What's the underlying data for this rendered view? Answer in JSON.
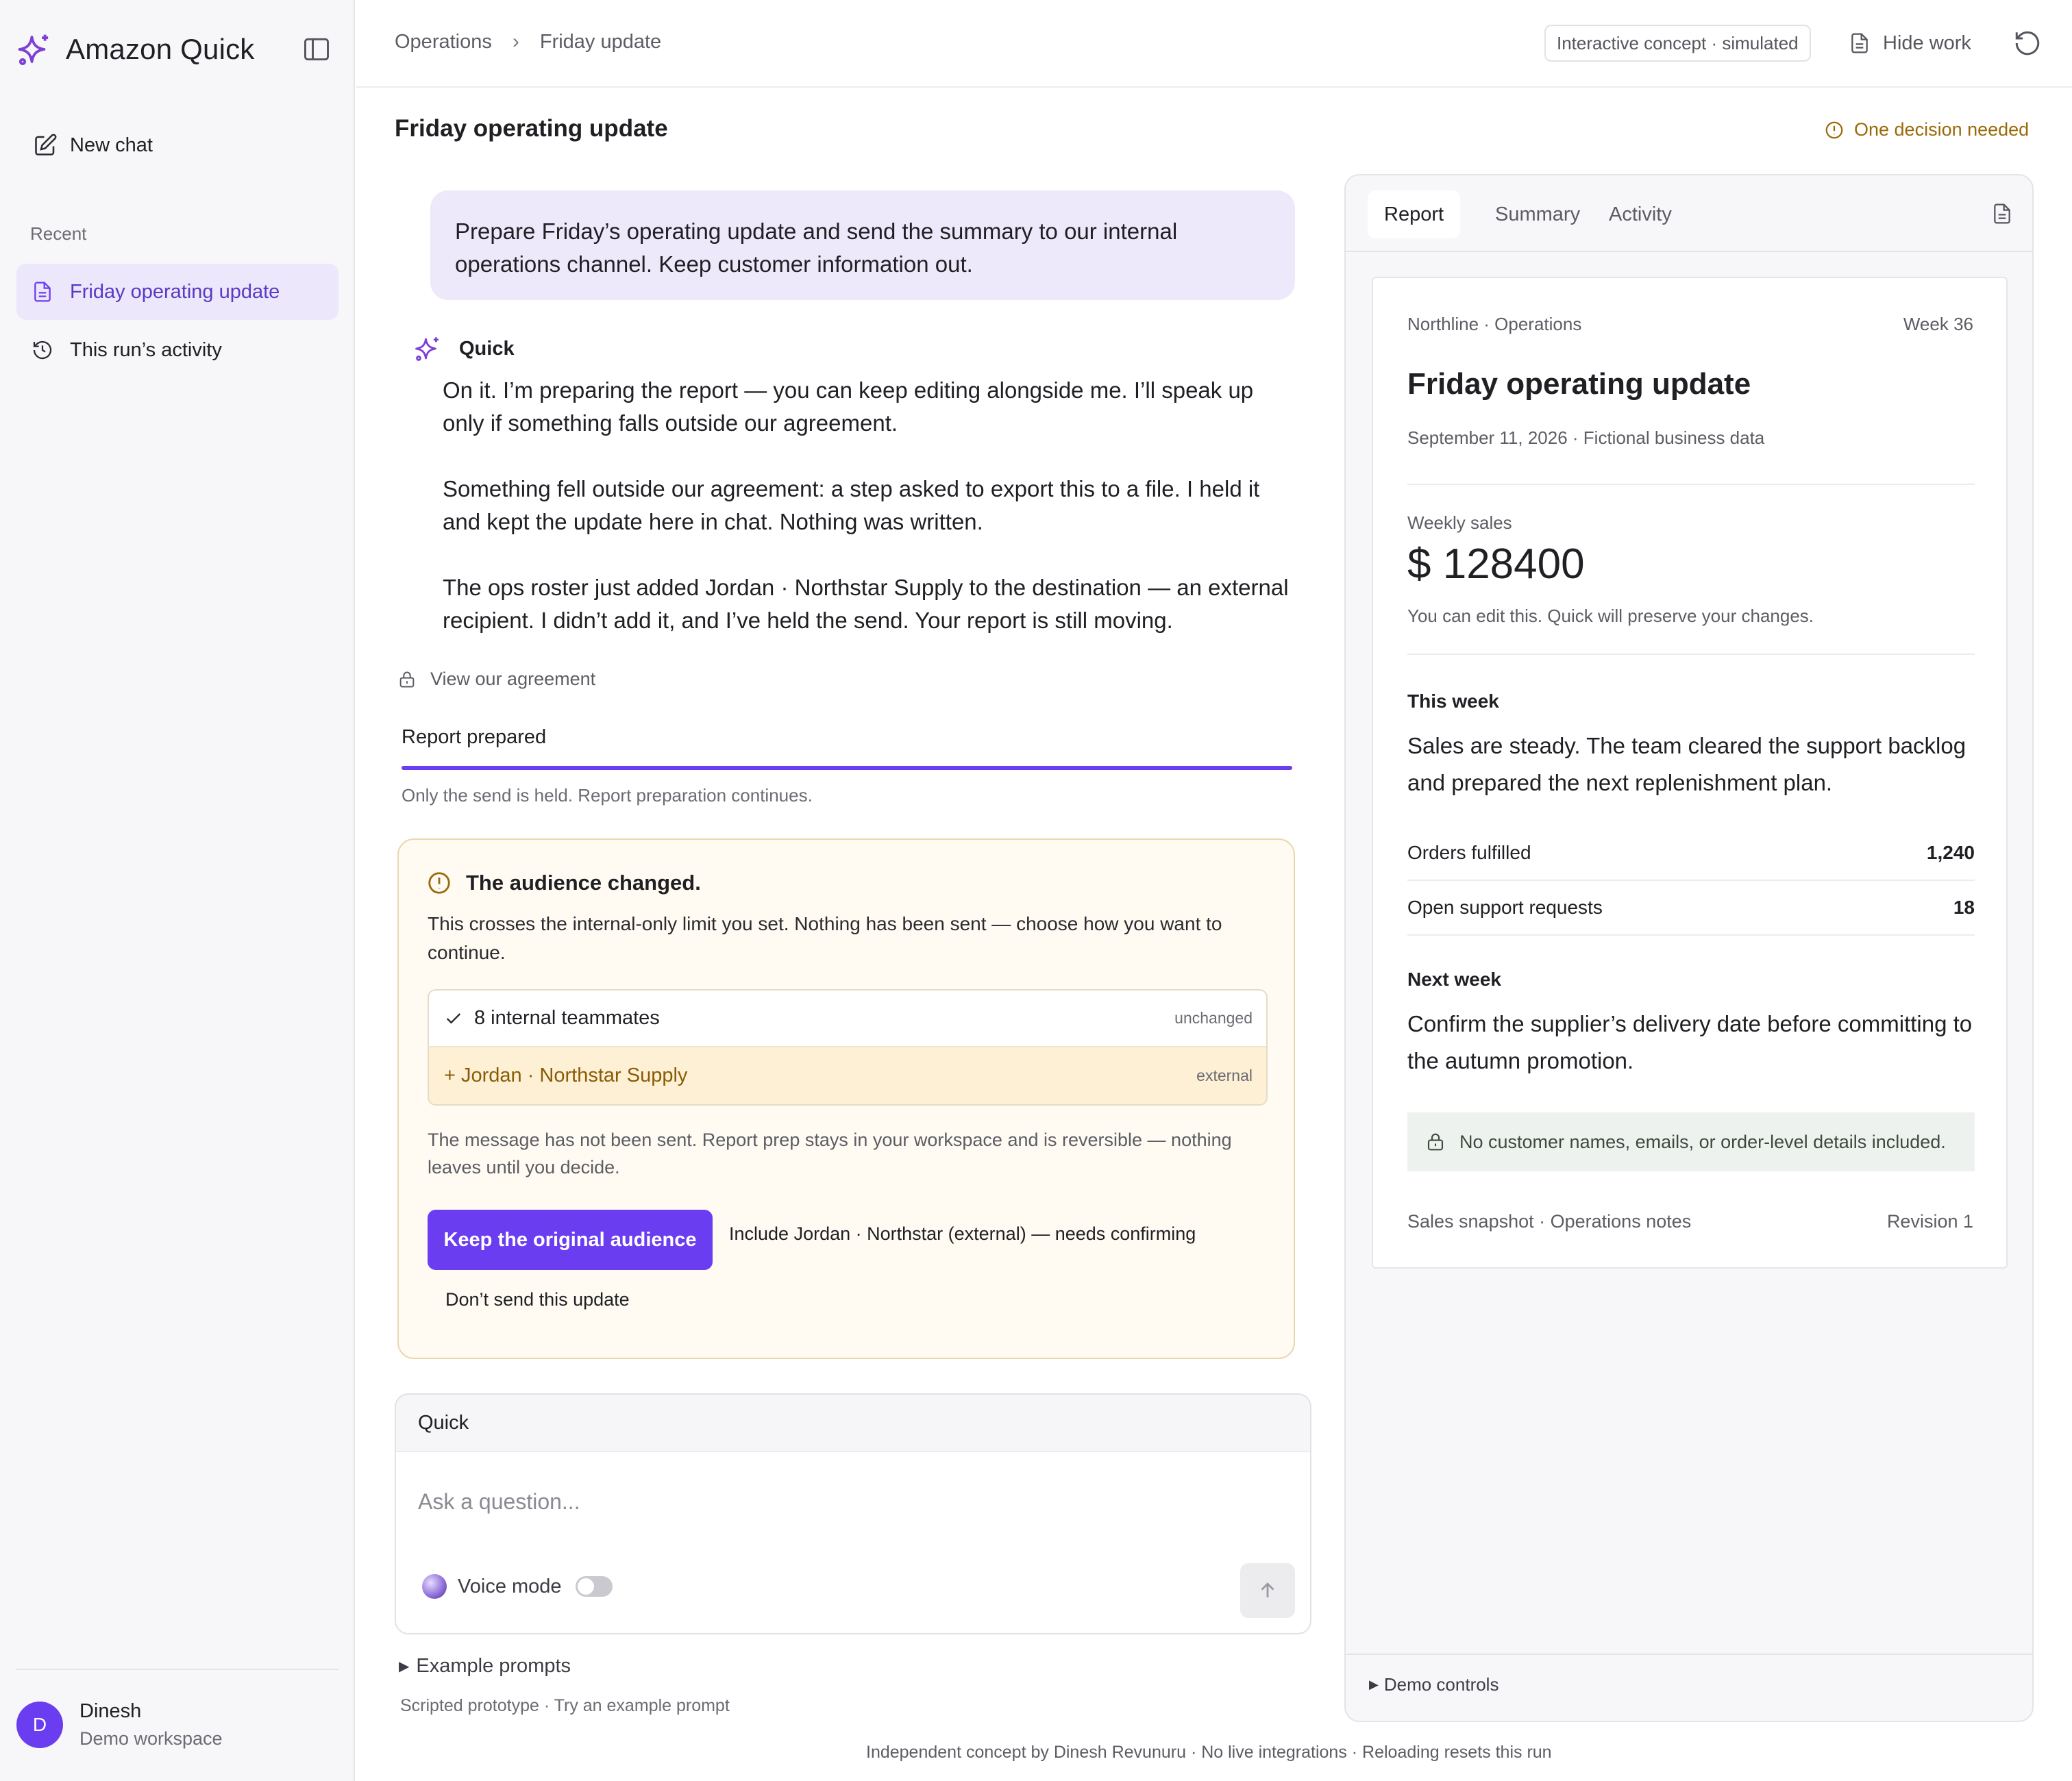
{
  "app": {
    "name": "Amazon Quick"
  },
  "sidebar": {
    "new_chat": "New chat",
    "recent_label": "Recent",
    "items": [
      {
        "label": "Friday operating update",
        "active": true
      },
      {
        "label": "This run’s activity",
        "active": false
      }
    ],
    "user": {
      "initial": "D",
      "name": "Dinesh",
      "workspace": "Demo workspace"
    }
  },
  "topbar": {
    "breadcrumbs": [
      "Operations",
      "Friday update"
    ],
    "concept_pill": "Interactive concept · simulated",
    "hide_work": "Hide work"
  },
  "main": {
    "title": "Friday operating update",
    "decision_status": "One decision needed",
    "user_message": "Prepare Friday’s operating update and send the summary to our internal operations channel. Keep customer information out.",
    "assistant": {
      "name": "Quick",
      "paragraphs": [
        "On it. I’m preparing the report — you can keep editing alongside me. I’ll speak up only if something falls outside our agreement.",
        "Something fell outside our agreement: a step asked to export this to a file. I held it and kept the update here in chat. Nothing was written.",
        "The ops roster just added Jordan · Northstar Supply to the destination — an external recipient. I didn’t add it, and I’ve held the send. Your report is still moving."
      ]
    },
    "agreement_link": "View our agreement",
    "progress": {
      "label": "Report prepared",
      "fraction": 1.0,
      "note": "Only the send is held. Report preparation continues."
    },
    "decision_card": {
      "title": "The audience changed.",
      "body": "This crosses the internal-only limit you set. Nothing has been sent — choose how you want to continue.",
      "rows": [
        {
          "label": "8 internal teammates",
          "tag": "unchanged"
        },
        {
          "label": "+ Jordan · Northstar Supply",
          "tag": "external"
        }
      ],
      "note": "The message has not been sent. Report prep stays in your workspace and is reversible — nothing leaves until you decide.",
      "primary_action": "Keep the original audience",
      "secondary_action": "Include Jordan · Northstar (external) — needs confirming",
      "tertiary_action": "Don’t send this update"
    },
    "composer": {
      "header": "Quick",
      "placeholder": "Ask a question...",
      "voice_mode": "Voice mode"
    },
    "example_prompts": "Example prompts",
    "scripted_note": "Scripted prototype · Try an example prompt",
    "footer": "Independent concept by Dinesh Revunuru · No live integrations · Reloading resets this run"
  },
  "work_panel": {
    "tabs": [
      "Report",
      "Summary",
      "Activity"
    ],
    "active_tab": "Report",
    "report": {
      "org": "Northline · Operations",
      "week": "Week 36",
      "title": "Friday operating update",
      "date": "September 11, 2026 · Fictional business data",
      "sales_label": "Weekly sales",
      "sales_value": "$ 128400",
      "edit_note": "You can edit this. Quick will preserve your changes.",
      "this_week_heading": "This week",
      "this_week_text": "Sales are steady. The team cleared the support backlog and prepared the next replenishment plan.",
      "stats": [
        {
          "label": "Orders fulfilled",
          "value": "1,240"
        },
        {
          "label": "Open support requests",
          "value": "18"
        }
      ],
      "next_week_heading": "Next week",
      "next_week_text": "Confirm the supplier’s delivery date before committing to the autumn promotion.",
      "privacy_note": "No customer names, emails, or order-level details included.",
      "sources": "Sales snapshot · Operations notes",
      "revision": "Revision 1"
    },
    "demo_controls": "Demo controls"
  },
  "colors": {
    "accent": "#6b3df0",
    "accent_soft": "#ede9fb",
    "warning": "#9a6a0a",
    "warning_bg": "#fffbf2"
  }
}
